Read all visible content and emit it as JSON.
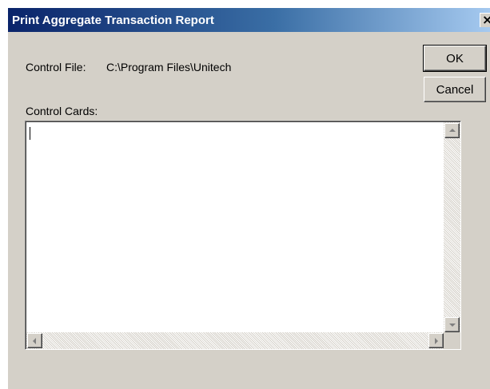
{
  "window": {
    "title": "Print Aggregate Transaction Report",
    "close_glyph": "×"
  },
  "control_file": {
    "label": "Control File:",
    "value": "C:\\Program Files\\Unitech"
  },
  "control_cards": {
    "label": "Control Cards:",
    "value": ""
  },
  "buttons": {
    "ok_label": "OK",
    "cancel_label": "Cancel"
  },
  "icons": {
    "close": "close-icon",
    "scroll_up": "scroll-up-arrow-icon",
    "scroll_down": "scroll-down-arrow-icon",
    "scroll_left": "scroll-left-arrow-icon",
    "scroll_right": "scroll-right-arrow-icon"
  },
  "colors": {
    "titlebar_start": "#0a246a",
    "titlebar_end": "#a6caf0",
    "dialog_face": "#d4d0c8"
  }
}
